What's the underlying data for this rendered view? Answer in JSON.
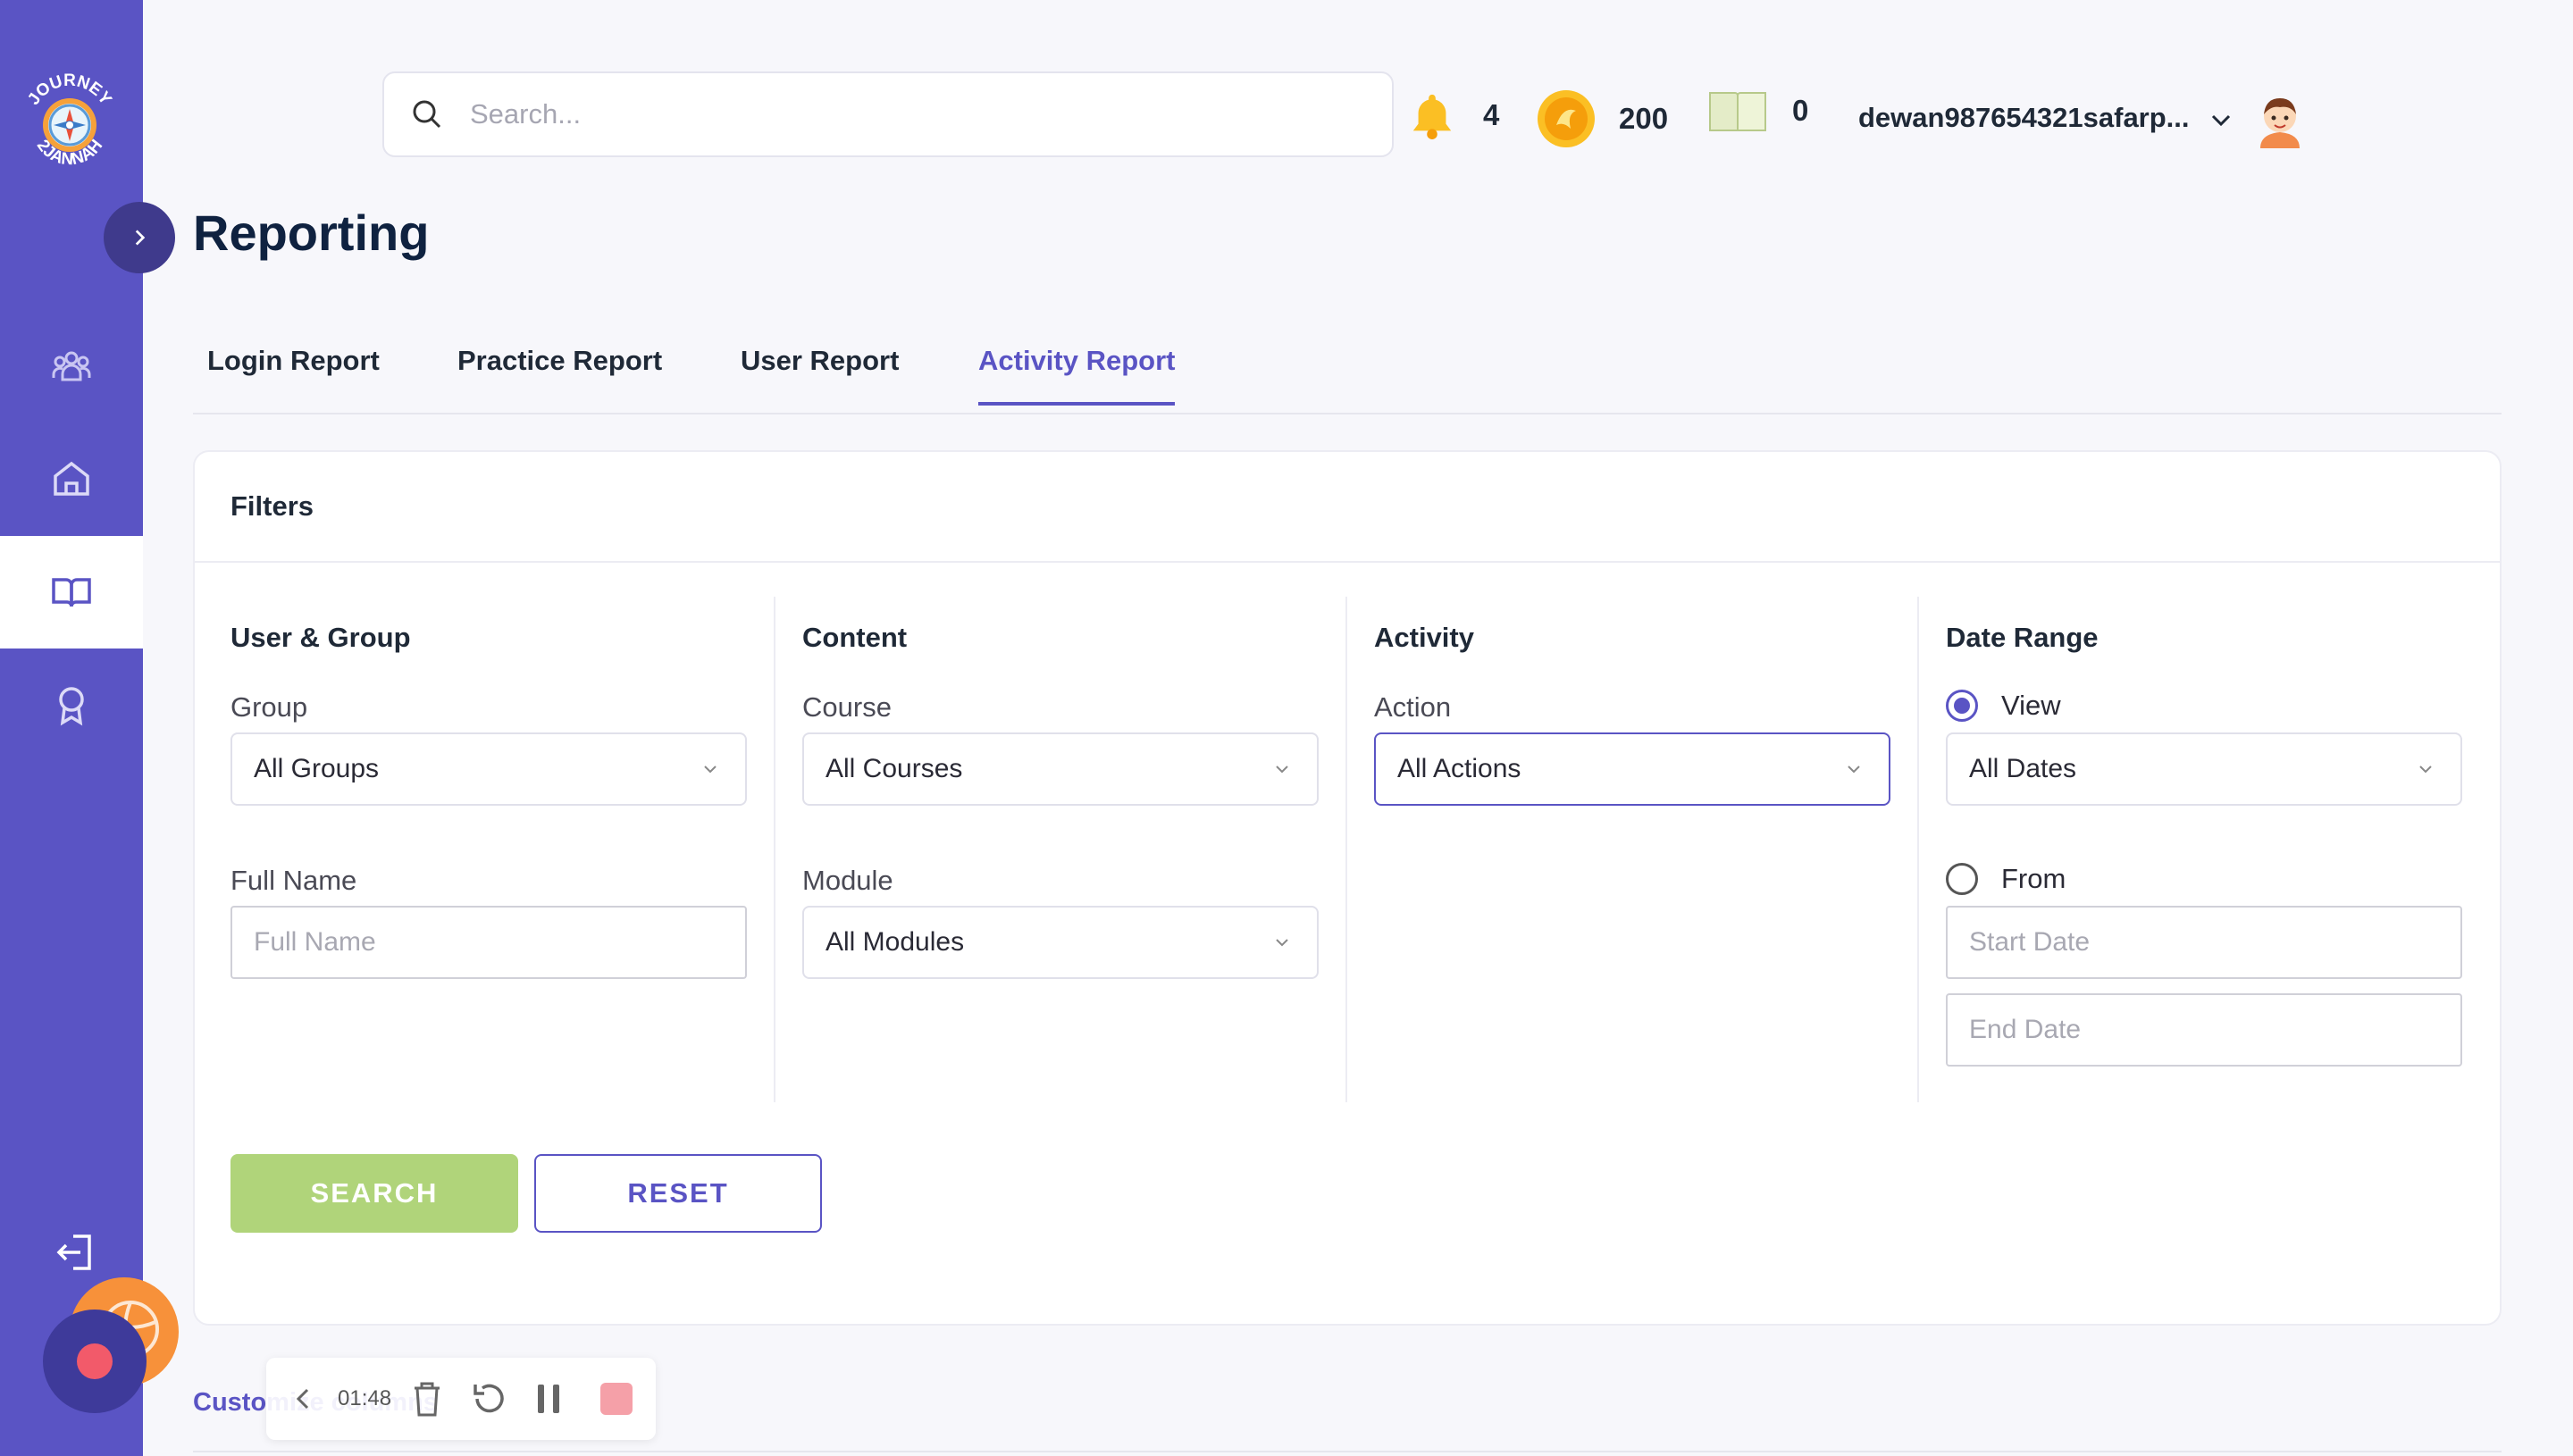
{
  "brand": {
    "logo_text_top": "JOURNEY",
    "logo_text_bottom": "2JANNAH"
  },
  "header": {
    "search_placeholder": "Search...",
    "notifications_count": "4",
    "coins": "200",
    "books": "0",
    "username": "dewan987654321safarp..."
  },
  "page": {
    "title": "Reporting"
  },
  "tabs": [
    {
      "label": "Login Report"
    },
    {
      "label": "Practice Report"
    },
    {
      "label": "User Report"
    },
    {
      "label": "Activity Report",
      "active": true
    }
  ],
  "filters": {
    "title": "Filters",
    "user_group": {
      "title": "User & Group",
      "group_label": "Group",
      "group_value": "All Groups",
      "fullname_label": "Full Name",
      "fullname_placeholder": "Full Name"
    },
    "content": {
      "title": "Content",
      "course_label": "Course",
      "course_value": "All Courses",
      "module_label": "Module",
      "module_value": "All Modules"
    },
    "activity": {
      "title": "Activity",
      "action_label": "Action",
      "action_value": "All Actions"
    },
    "date_range": {
      "title": "Date Range",
      "view_label": "View",
      "view_value": "All Dates",
      "from_label": "From",
      "start_placeholder": "Start Date",
      "end_placeholder": "End Date",
      "selected": "view"
    },
    "search_button": "SEARCH",
    "reset_button": "RESET"
  },
  "footer": {
    "customize_label": "Customize columns"
  },
  "recorder": {
    "time": "01:48"
  },
  "colors": {
    "sidebar": "#5a54c4",
    "accent": "#5a54c4",
    "search_button": "#b0d47a",
    "recorder_stop": "#f5a0a8"
  },
  "icons": {
    "sidebar": [
      "users-icon",
      "home-icon",
      "book-open-icon",
      "award-icon",
      "logout-icon"
    ],
    "header": [
      "search-icon",
      "bell-icon",
      "coin-icon",
      "book-icon",
      "chevron-down-icon"
    ]
  }
}
